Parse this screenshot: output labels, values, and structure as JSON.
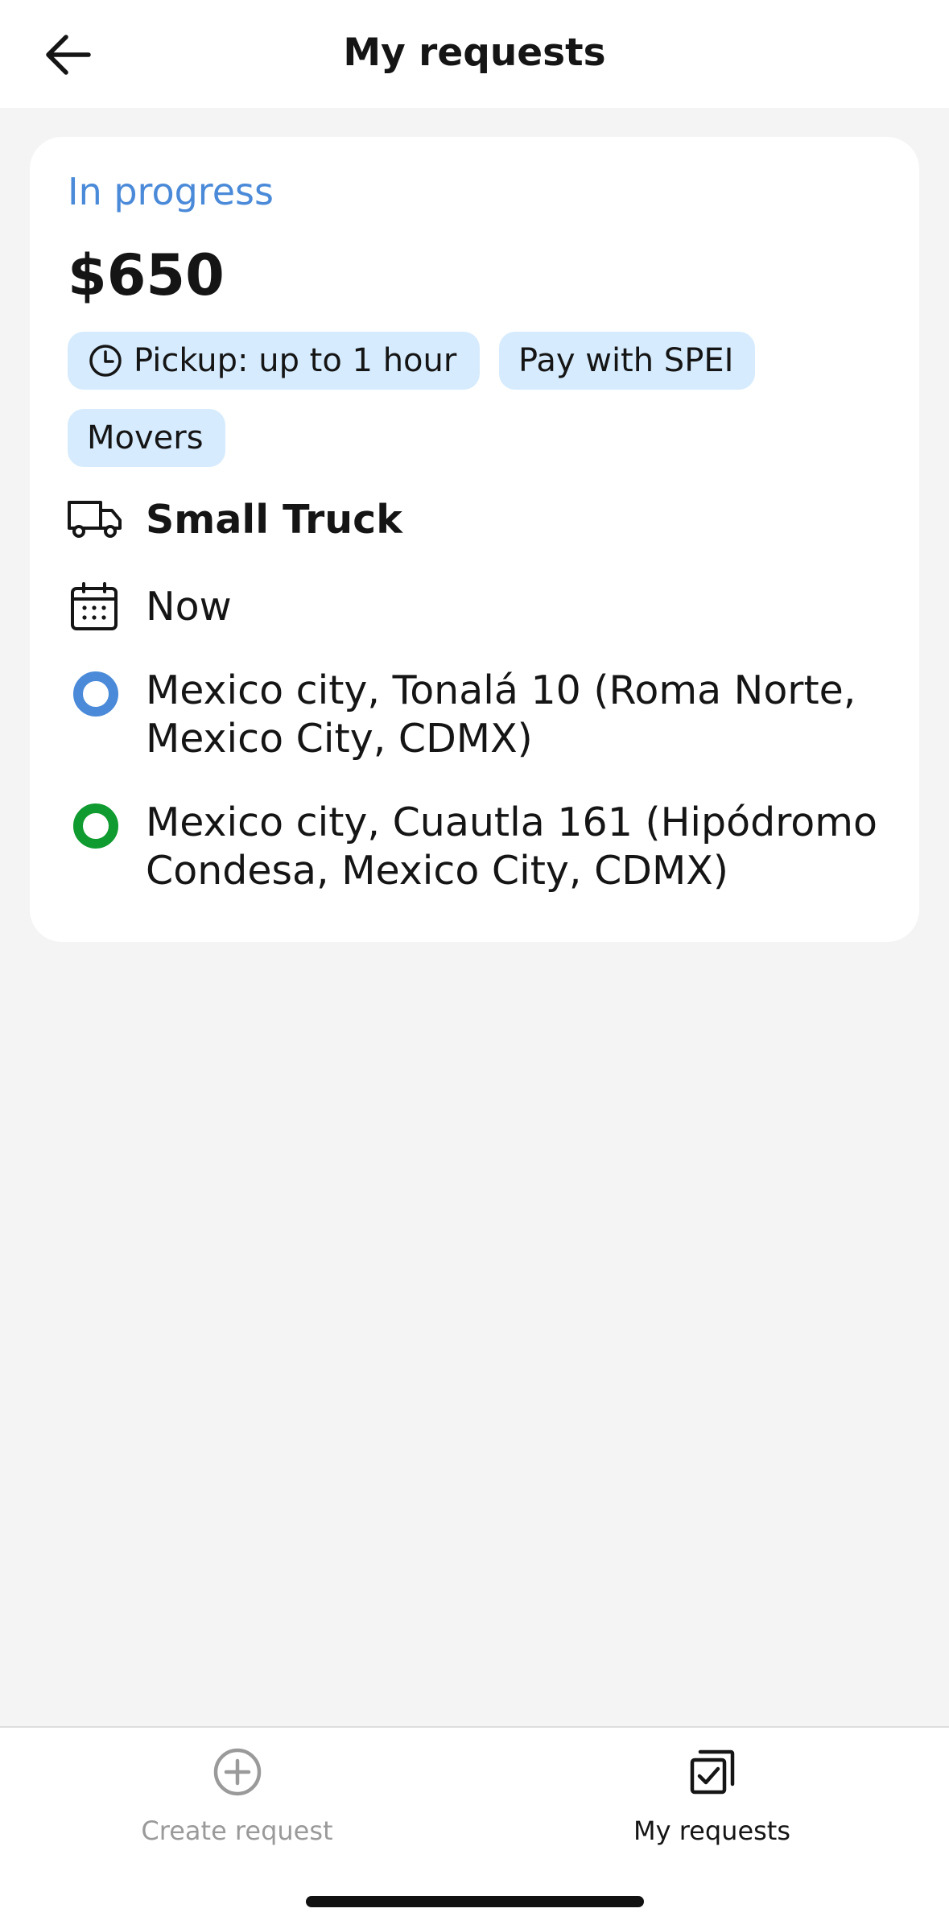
{
  "header": {
    "title": "My requests",
    "back_icon": "arrow-left-icon"
  },
  "request": {
    "status": "In progress",
    "status_color": "#4a8ad8",
    "price": "$650",
    "chips": {
      "pickup": "Pickup: up to 1 hour",
      "payment": "Pay with SPEI",
      "movers": "Movers"
    },
    "chip_color": "#d6ebfd",
    "vehicle": "Small Truck",
    "time": "Now",
    "origin": "Mexico city, Tonalá 10 (Roma Norte, Mexico City, CDMX)",
    "origin_color": "#4a8ad8",
    "destination": "Mexico city, Cuautla 161 (Hipódromo Condesa, Mexico City, CDMX)",
    "destination_color": "#0f9b2f"
  },
  "nav": {
    "create_label": "Create request",
    "create_icon": "plus-circle-icon",
    "mine_label": "My requests",
    "mine_icon": "checked-stack-icon"
  }
}
